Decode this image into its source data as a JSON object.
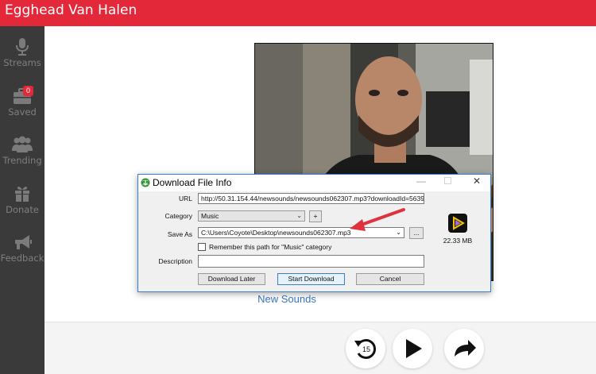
{
  "header": {
    "title": "Egghead Van Halen"
  },
  "sidebar": {
    "items": [
      {
        "label": "Streams",
        "icon": "microphone-icon"
      },
      {
        "label": "Saved",
        "icon": "briefcase-icon",
        "badge": "0"
      },
      {
        "label": "Trending",
        "icon": "people-icon"
      },
      {
        "label": "Donate",
        "icon": "gift-icon"
      },
      {
        "label": "Feedback",
        "icon": "megaphone-icon"
      }
    ]
  },
  "main": {
    "track_title": "New Sounds"
  },
  "player": {
    "rewind_seconds": "15",
    "buttons": [
      "rewind-15-icon",
      "play-icon",
      "share-icon"
    ]
  },
  "dialog": {
    "title": "Download File Info",
    "url_label": "URL",
    "url_value": "http://50.31.154.44/newsounds/newsounds062307.mp3?downloadId=5639",
    "category_label": "Category",
    "category_value": "Music",
    "add_label": "+",
    "saveas_label": "Save As",
    "saveas_value": "C:\\Users\\Coyote\\Desktop\\newsounds062307.mp3",
    "browse_label": "...",
    "remember_label": "Remember this path for \"Music\" category",
    "description_label": "Description",
    "description_value": "",
    "file_size": "22.33  MB",
    "download_later": "Download Later",
    "start_download": "Start Download",
    "cancel": "Cancel",
    "window_controls": {
      "minimize": "—",
      "maximize": "☐",
      "close": "✕"
    }
  },
  "colors": {
    "brand": "#e3283a",
    "sidebar": "#3a3a3a",
    "link": "#3a77c4",
    "arrow": "#e0323c"
  }
}
